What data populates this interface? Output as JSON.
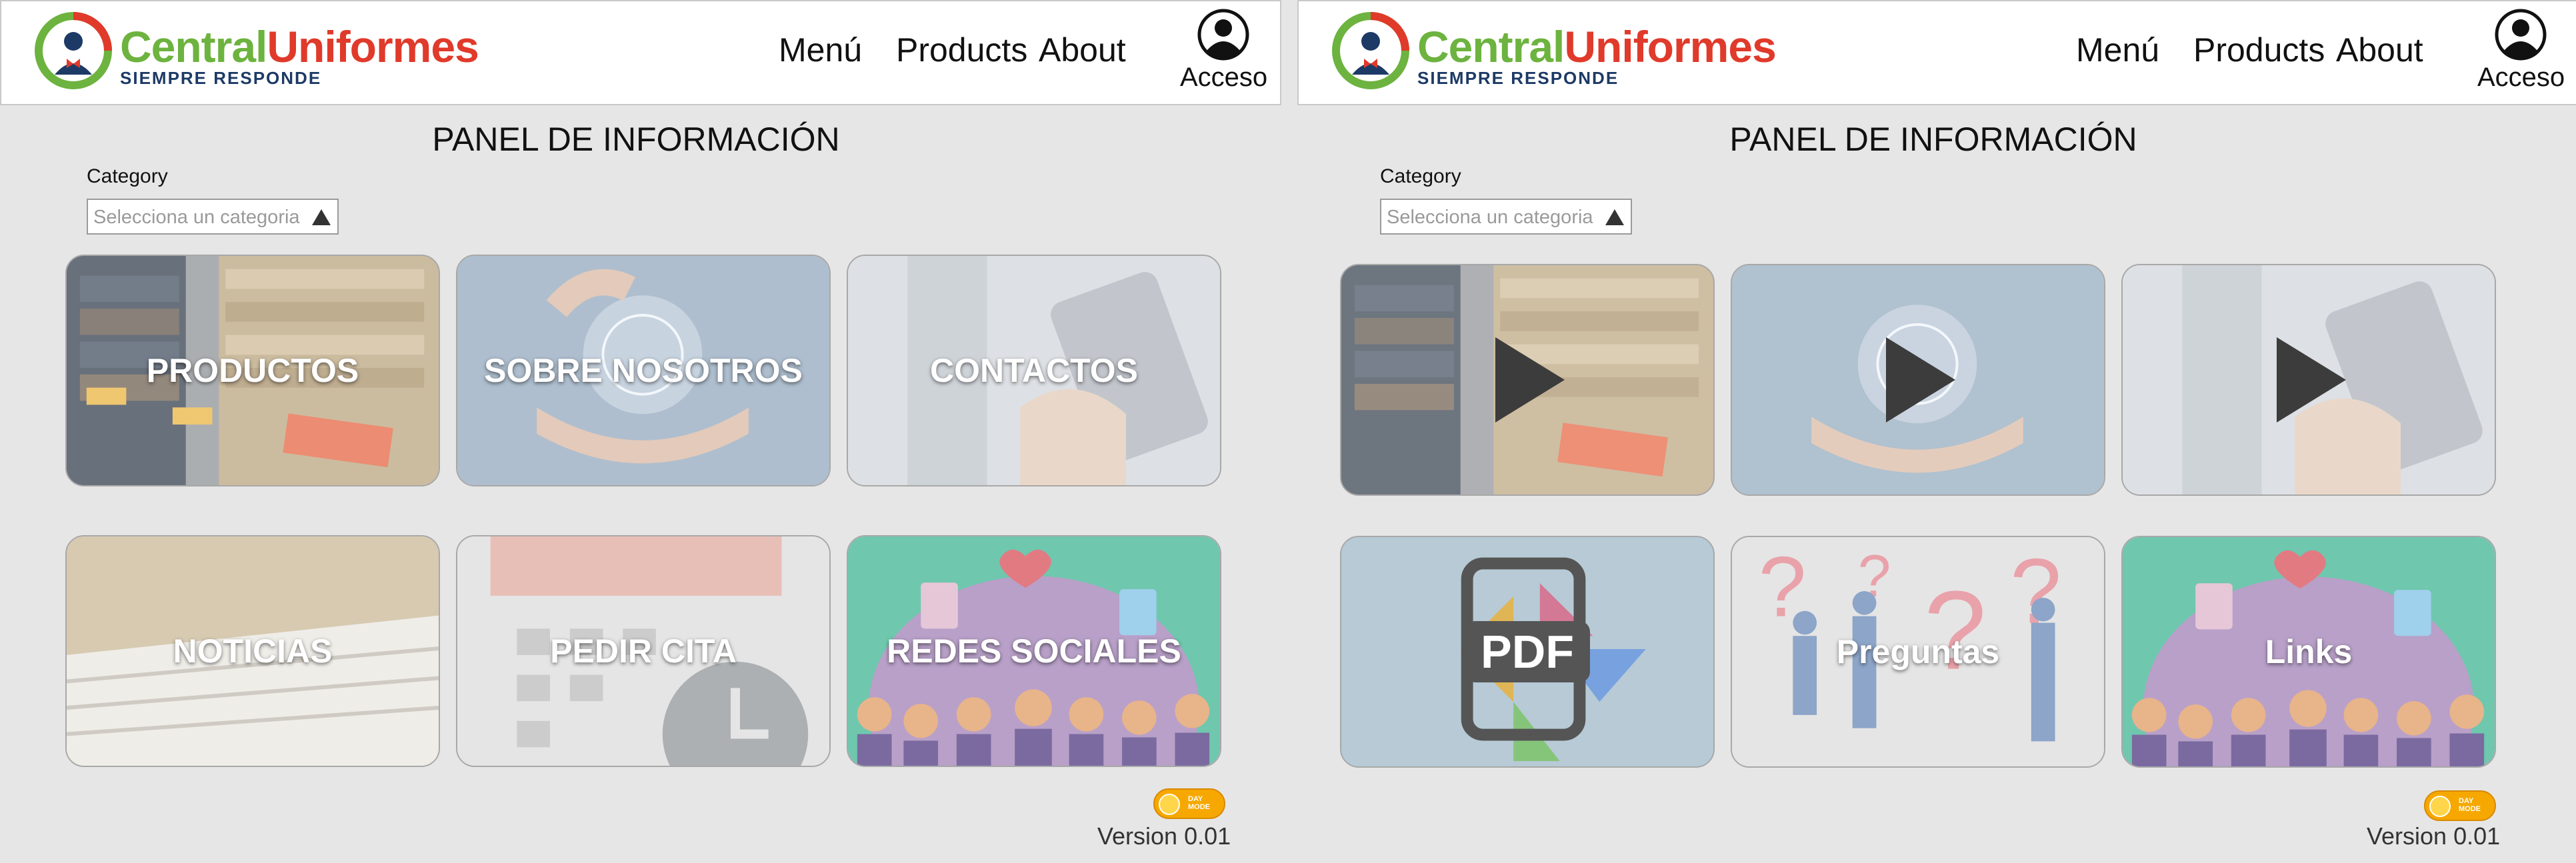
{
  "brand": {
    "name_part1": "Central",
    "name_part2": "Uniformes",
    "tagline": "SIEMPRE RESPONDE",
    "color_green": "#6db33f",
    "color_red": "#e03a2b",
    "color_navy": "#1d3a66"
  },
  "nav": {
    "menu": "Menú",
    "products": "Products",
    "about": "About",
    "acceso": "Acceso"
  },
  "panel": {
    "title": "PANEL DE INFORMACIÓN",
    "category_label": "Category",
    "category_placeholder": "Selecciona un categoria"
  },
  "left_tiles": [
    {
      "label": "PRODUCTOS",
      "image": "clothing-rack"
    },
    {
      "label": "SOBRE NOSOTROS",
      "image": "hands-globe"
    },
    {
      "label": "CONTACTOS",
      "image": "phone-contacts"
    },
    {
      "label": "NOTICIAS",
      "image": "newspaper"
    },
    {
      "label": "PEDIR CITA",
      "image": "calendar-clock"
    },
    {
      "label": "REDES SOCIALES",
      "image": "social-people"
    }
  ],
  "right_tiles": [
    {
      "label": "",
      "image": "clothing-rack",
      "overlay": "play-icon"
    },
    {
      "label": "",
      "image": "hands-globe",
      "overlay": "play-icon"
    },
    {
      "label": "",
      "image": "phone-contacts",
      "overlay": "play-icon"
    },
    {
      "label": "PDF",
      "image": "pdf-document"
    },
    {
      "label": "Preguntas",
      "image": "question-people"
    },
    {
      "label": "Links",
      "image": "social-people"
    }
  ],
  "footer": {
    "mode_label_1": "DAY",
    "mode_label_2": "MODE",
    "version": "Version 0.01"
  }
}
